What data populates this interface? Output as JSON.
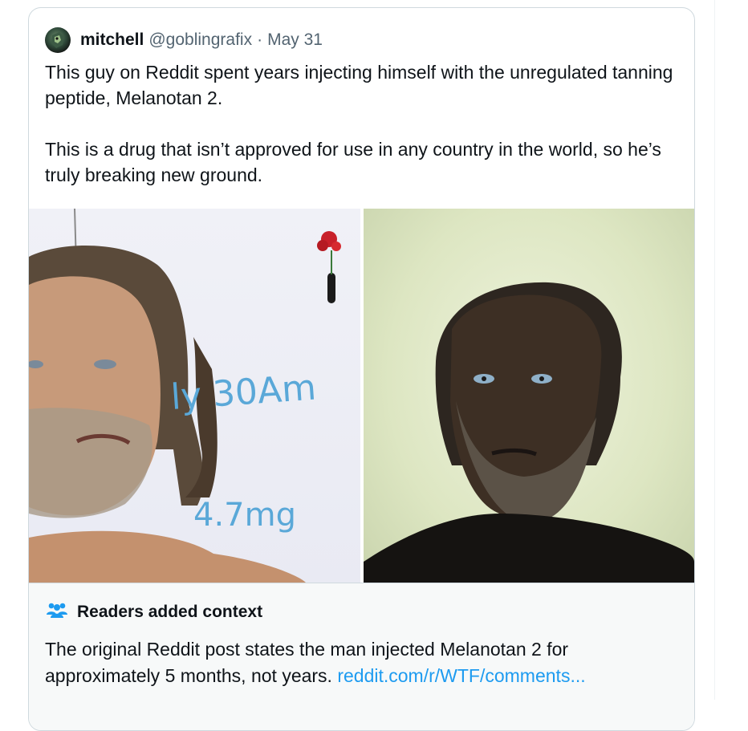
{
  "tweet": {
    "author_name": "mitchell",
    "author_handle": "@goblingrafix",
    "separator": "·",
    "date": "May 31",
    "text": "This guy on Reddit spent years injecting himself with the unregulated tanning peptide, Melanotan 2.\n\nThis is a drug that isn’t approved for use in any country in the world, so he’s truly breaking new ground."
  },
  "media": {
    "left_photo": {
      "whiteboard_line1": "ly 30Am",
      "whiteboard_line2": "4.7mg"
    },
    "right_photo": {}
  },
  "community_note": {
    "title": "Readers added context",
    "body": "The original Reddit post states the man injected Melanotan 2 for approximately 5 months, not years. ",
    "link_text": "reddit.com/r/WTF/comments..."
  },
  "colors": {
    "link": "#1d9bf0",
    "secondary_text": "#536471",
    "border": "#cfd9de",
    "note_background": "#f7f9f9"
  },
  "icons": [
    "avatar-image",
    "people-group-icon"
  ]
}
